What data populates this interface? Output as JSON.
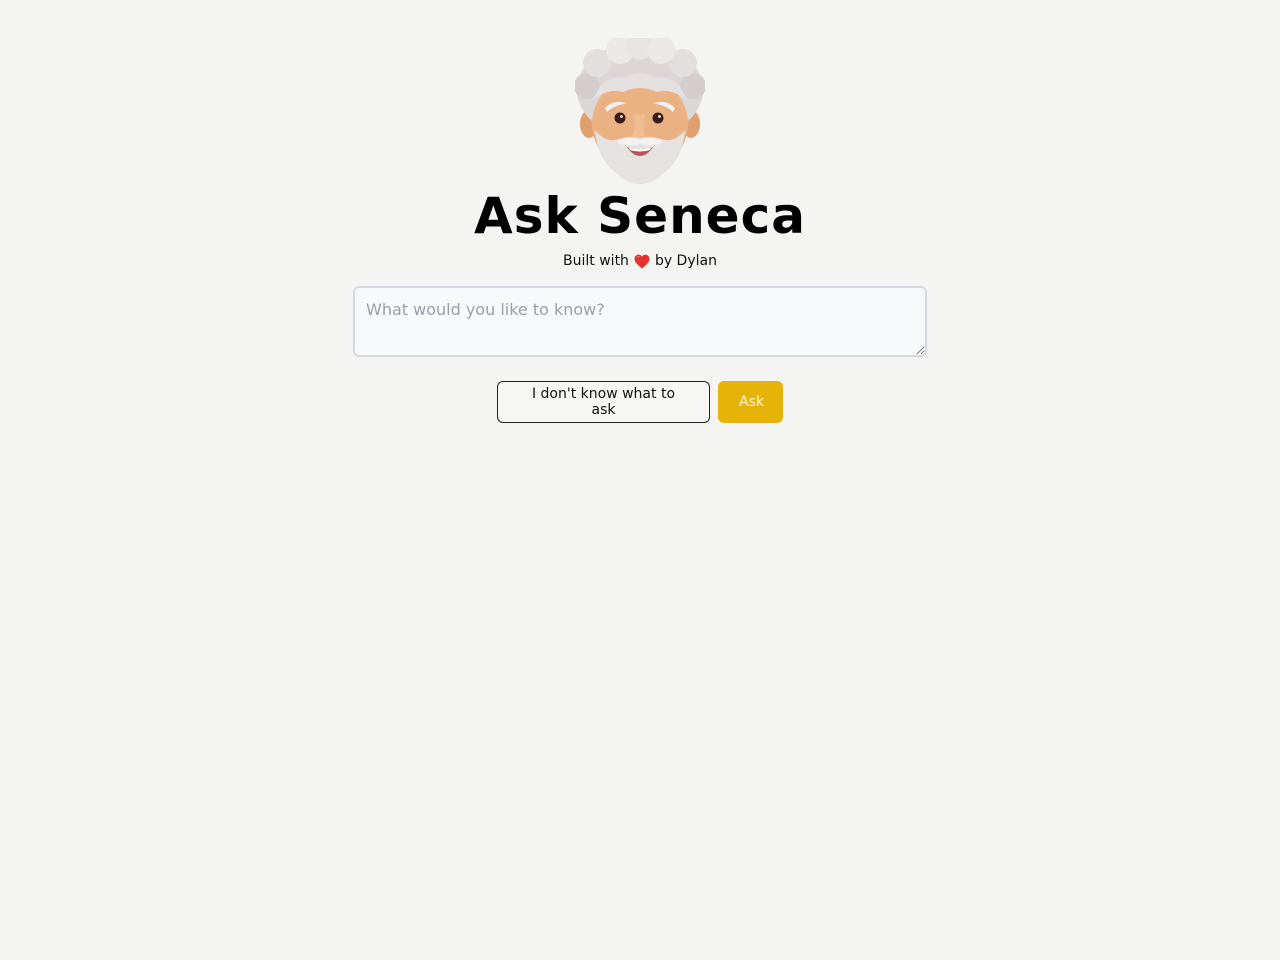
{
  "hero": {
    "avatar_icon": "old-man-emoji-icon",
    "title": "Ask Seneca",
    "byline_prefix": "Built with",
    "heart_icon": "red-heart-icon",
    "byline_suffix": "by Dylan"
  },
  "question": {
    "value": "",
    "placeholder": "What would you like to know?"
  },
  "actions": {
    "random_label": "I don't know what to ask",
    "ask_label": "Ask"
  },
  "colors": {
    "background": "#f4f4f2",
    "accent": "#e6b308",
    "heart": "#e5322e"
  }
}
